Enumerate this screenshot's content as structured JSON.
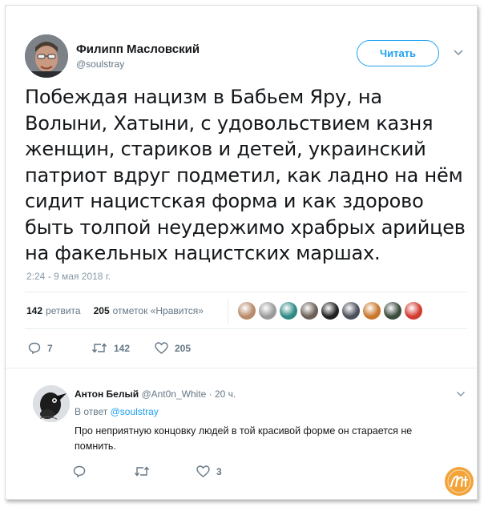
{
  "author": {
    "name": "Филипп Масловский",
    "handle": "@soulstray",
    "follow_label": "Читать"
  },
  "tweet": {
    "lines": [
      "Побеждая нацизм в Бабьем Яру, на",
      "Волыни, Хатыни, с удовольствием казня",
      "женщин, стариков и детей, украинский",
      "патриот вдруг подметил, как ладно на нём",
      "сидит нацистская форма и как здорово",
      "быть толпой неудержимо храбрых арийцев",
      "на факельных нацистских маршах."
    ],
    "timestamp": "2:24 - 9 мая 2018 г."
  },
  "stats": {
    "retweets_count": "142",
    "retweets_label": "ретвита",
    "likes_count": "205",
    "likes_label": "отметок «Нравится»"
  },
  "likers": [
    {
      "icon": "avatar-icon",
      "color": "#b98a6a"
    },
    {
      "icon": "avatar-icon",
      "color": "#9a9a9a"
    },
    {
      "icon": "avatar-icon",
      "color": "#2e8a84"
    },
    {
      "icon": "avatar-icon",
      "color": "#6b5f58"
    },
    {
      "icon": "avatar-icon",
      "color": "#222222"
    },
    {
      "icon": "avatar-icon",
      "color": "#4a4f5a"
    },
    {
      "icon": "avatar-icon",
      "color": "#c8772a"
    },
    {
      "icon": "avatar-icon",
      "color": "#3a4b3c"
    },
    {
      "icon": "avatar-icon",
      "color": "#d23b2f"
    }
  ],
  "actions": {
    "replies": "7",
    "retweets": "142",
    "likes": "205"
  },
  "reply": {
    "name": "Антон Белый",
    "handle": "@Ant0n_White",
    "time": "· 20 ч.",
    "in_reply_prefix": "В ответ",
    "in_reply_handle": "@soulstray",
    "text": "Про неприятную концовку людей в той красивой форме он старается не помнить.",
    "likes": "3"
  },
  "colors": {
    "accent": "#1da1f2",
    "muted": "#657786",
    "text": "#14171a",
    "watermark": "#f2a33a"
  }
}
